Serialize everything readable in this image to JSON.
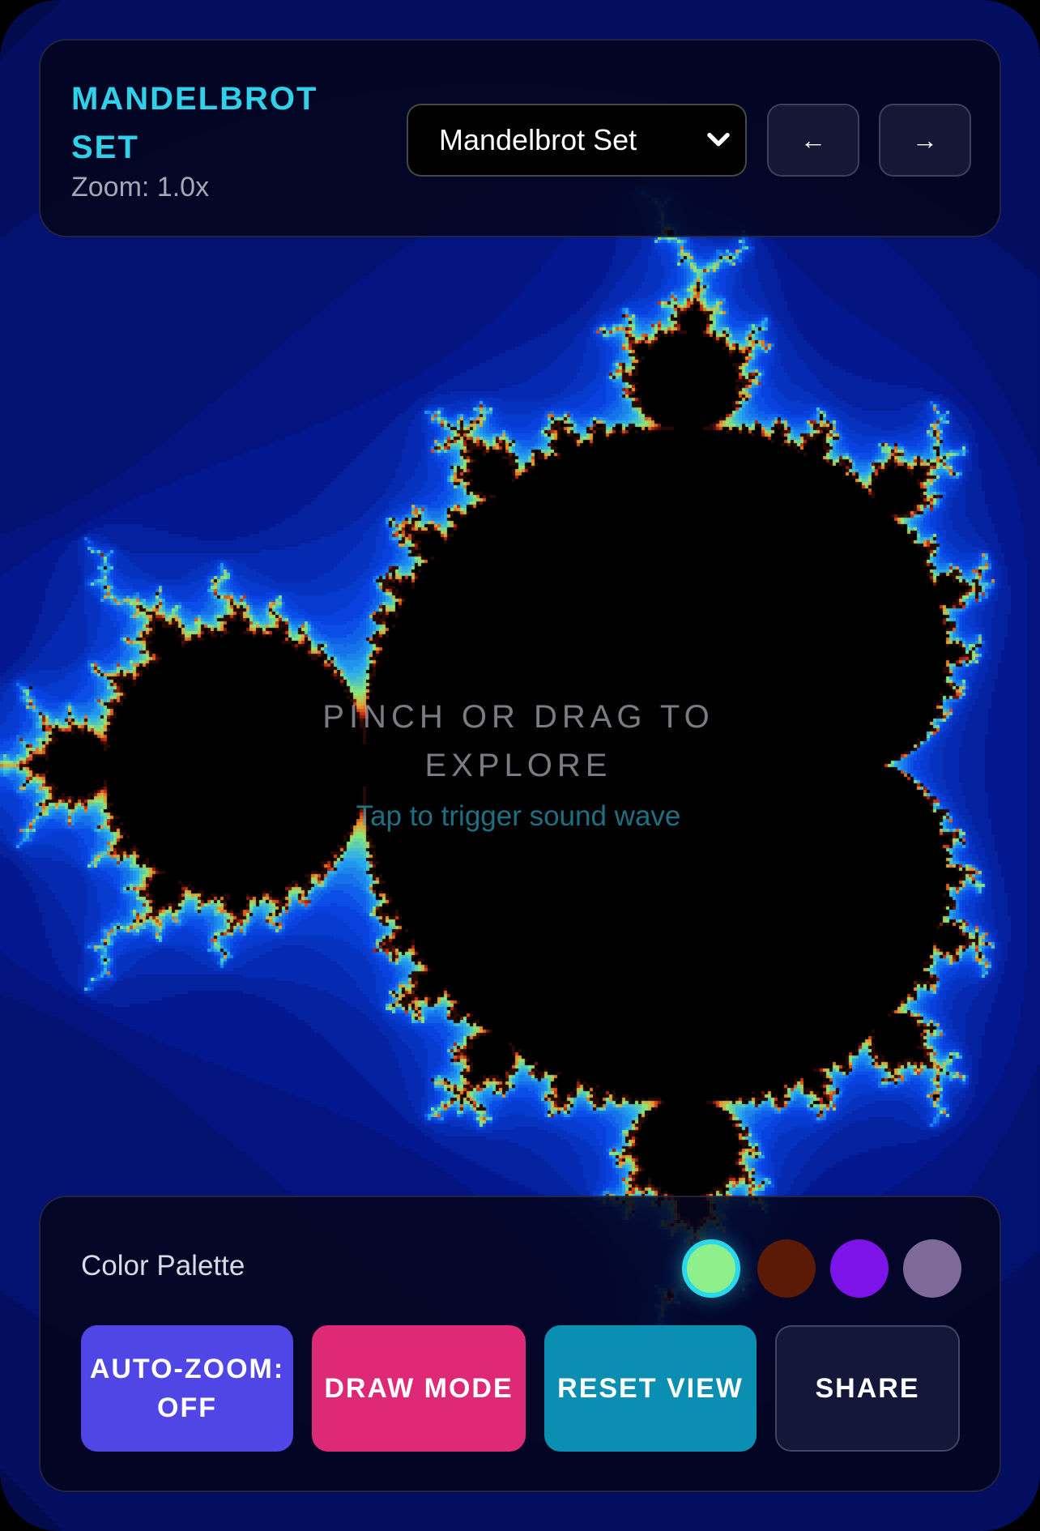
{
  "header": {
    "title": "MANDELBROT SET",
    "zoom_label": "Zoom: 1.0x",
    "fractal_select": {
      "selected": "Mandelbrot Set",
      "icon": "chevron-down-icon"
    },
    "prev_label": "←",
    "next_label": "→"
  },
  "overlay": {
    "title": "PINCH OR DRAG TO EXPLORE",
    "subtitle": "Tap to trigger sound wave"
  },
  "controls": {
    "palette_label": "Color Palette",
    "palette_swatches": [
      {
        "color": "#8ef08a",
        "selected": true
      },
      {
        "color": "#5a1a06",
        "selected": false
      },
      {
        "color": "#7c14ea",
        "selected": false
      },
      {
        "color": "#7e6a98",
        "selected": false
      }
    ],
    "auto_zoom_label": "AUTO-ZOOM: OFF",
    "draw_mode_label": "DRAW MODE",
    "reset_view_label": "RESET VIEW",
    "share_label": "SHARE"
  },
  "colors": {
    "title": "#2fd0e8",
    "auto_zoom_button": "#4f46e5",
    "draw_mode_button": "#de2977",
    "reset_view_button": "#0a8fb2",
    "share_button": "#13173a",
    "fractal_background": "#020733"
  }
}
